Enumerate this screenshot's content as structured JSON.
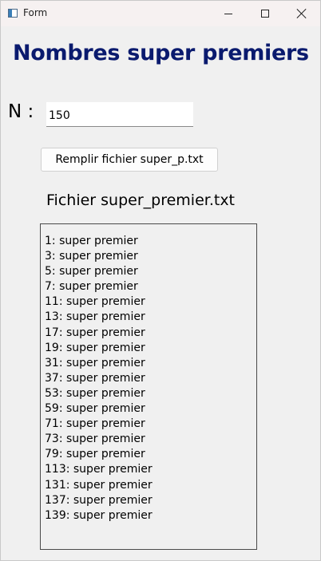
{
  "window": {
    "title": "Form",
    "controls": {
      "minimize": "minimize-icon",
      "maximize": "maximize-icon",
      "close": "close-icon"
    }
  },
  "main": {
    "heading": "Nombres super premiers",
    "n_label": "N :",
    "n_value": "150",
    "fill_button_label": "Remplir fichier super_p.txt",
    "file_label": "Fichier super_premier.txt",
    "results": [
      "1: super premier",
      "3: super premier",
      "5: super premier",
      "7: super premier",
      "11: super premier",
      "13: super premier",
      "17: super premier",
      "19: super premier",
      "31: super premier",
      "37: super premier",
      "53: super premier",
      "59: super premier",
      "71: super premier",
      "73: super premier",
      "79: super premier",
      "113: super premier",
      "131: super premier",
      "137: super premier",
      "139: super premier"
    ]
  },
  "colors": {
    "heading": "#0a1a6e",
    "background": "#f0f0f0",
    "titlebar": "#f6f1f1"
  }
}
